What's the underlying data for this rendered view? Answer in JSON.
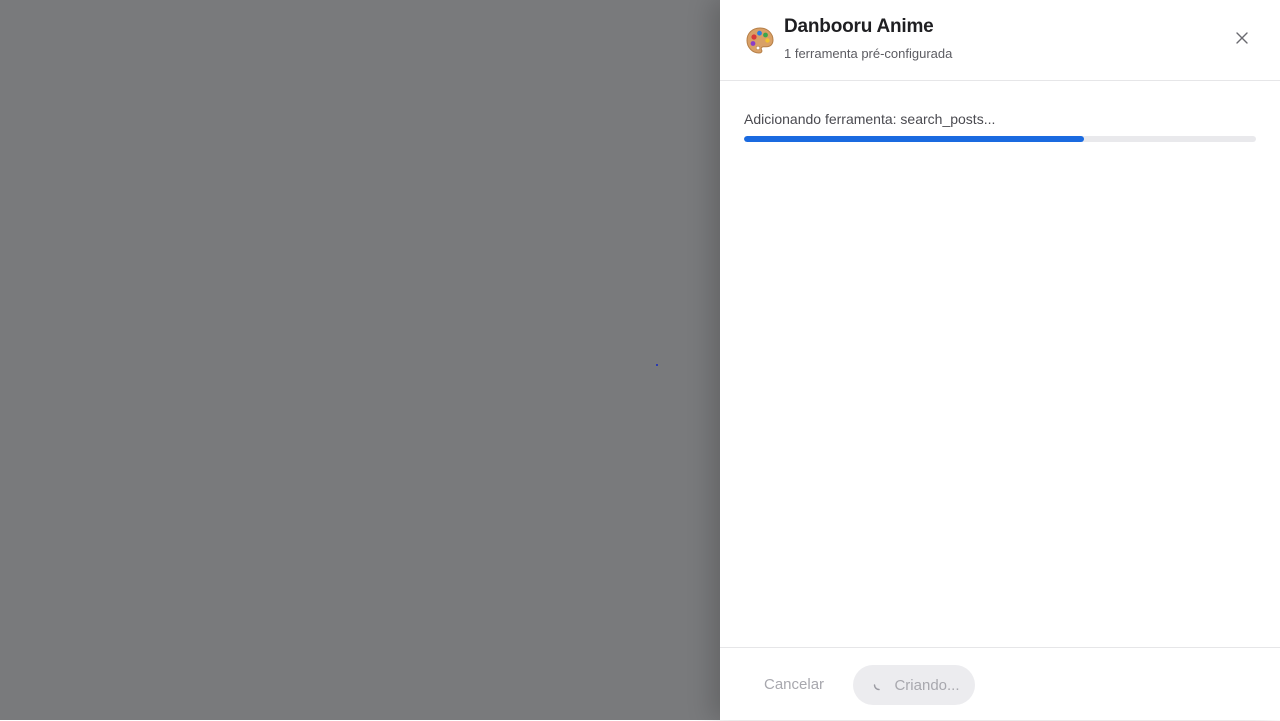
{
  "drawer": {
    "app_icon": "palette-icon",
    "title": "Danbooru Anime",
    "subtitle": "1 ferramenta pré-configurada",
    "close_icon": "close-icon"
  },
  "progress": {
    "status_text": "Adicionando ferramenta: search_posts...",
    "percent": 66.4,
    "color": "#1a6ae0"
  },
  "footer": {
    "cancel_label": "Cancelar",
    "create_label": "Criando...",
    "spinner_icon": "spinner-icon"
  }
}
